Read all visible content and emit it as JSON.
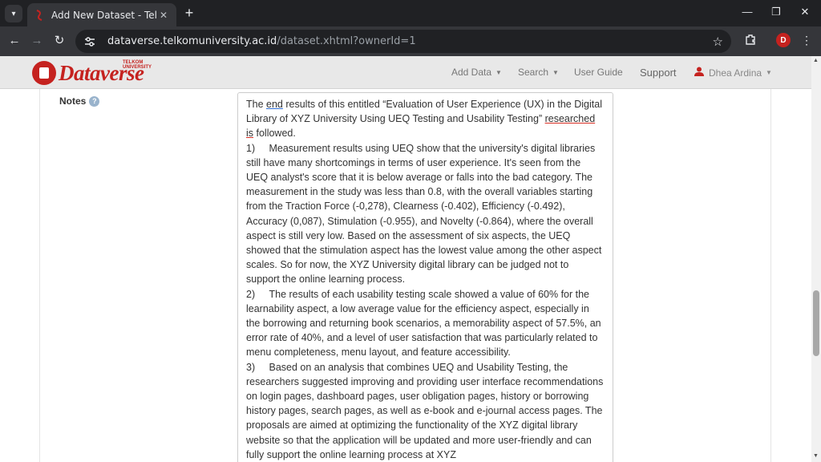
{
  "browser": {
    "tab_title": "Add New Dataset - Telkom University Dataverse",
    "tab_close": "✕",
    "new_tab": "+",
    "url_host": "dataverse.telkomuniversity.ac.id",
    "url_path": "/dataset.xhtml?ownerId=1",
    "profile_initial": "D",
    "window_controls": {
      "minimize": "—",
      "restore": "❐",
      "close": "✕"
    },
    "icons": [
      "tab-search-icon",
      "back-icon",
      "forward-icon",
      "reload-icon",
      "site-info-icon",
      "bookmark-star-icon",
      "extensions-icon",
      "more-menu-icon"
    ]
  },
  "navbar": {
    "logo_text": "Dataverse",
    "logo_sub": "TELKOM UNIVERSITY",
    "add_data": "Add Data",
    "search": "Search",
    "user_guide": "User Guide",
    "support": "Support",
    "user_name": "Dhea Ardina"
  },
  "form": {
    "notes_label": "Notes",
    "help_icon": "?",
    "notes_intro_1": "The ",
    "notes_intro_end": "end",
    "notes_intro_2": " results of this entitled “Evaluation of User Experience (UX) in the Digital Library of XYZ University Using UEQ Testing and Usability Testing” ",
    "notes_intro_gram": "researched is",
    "notes_intro_3": " followed.",
    "notes_item_1": "1)     Measurement results using UEQ show that the university's digital libraries still have many shortcomings in terms of user experience. It's seen from the UEQ analyst's score that it is below average or falls into the bad category. The measurement in the study was less than 0.8, with the overall variables starting from the Traction Force (-0,278), Clearness (-0.402), Efficiency (-0.492), Accuracy (0,087), Stimulation (-0.955), and Novelty (-0.864), where the overall aspect is still very low. Based on the assessment of six aspects, the UEQ showed that the stimulation aspect has the lowest value among the other aspect scales. So for now, the XYZ University digital library can be judged not to support the online learning process.",
    "notes_item_2": "2)     The results of each usability testing scale showed a value of 60% for the learnability aspect, a low average value for the efficiency aspect, especially in the borrowing and returning book scenarios, a memorability aspect of 57.5%, an error rate of 40%, and a level of user satisfaction that was particularly related to menu completeness, menu layout, and feature accessibility.",
    "notes_item_3": "3)     Based on an analysis that combines UEQ and Usability Testing, the researchers suggested improving and providing user interface recommendations on login pages, dashboard pages, user obligation pages, history or borrowing history pages, search pages, as well as e-book and e-journal access pages. The proposals are aimed at optimizing the functionality of the XYZ digital library website so that the application will be updated and more user-friendly and can fully support the online learning process at XYZ"
  }
}
